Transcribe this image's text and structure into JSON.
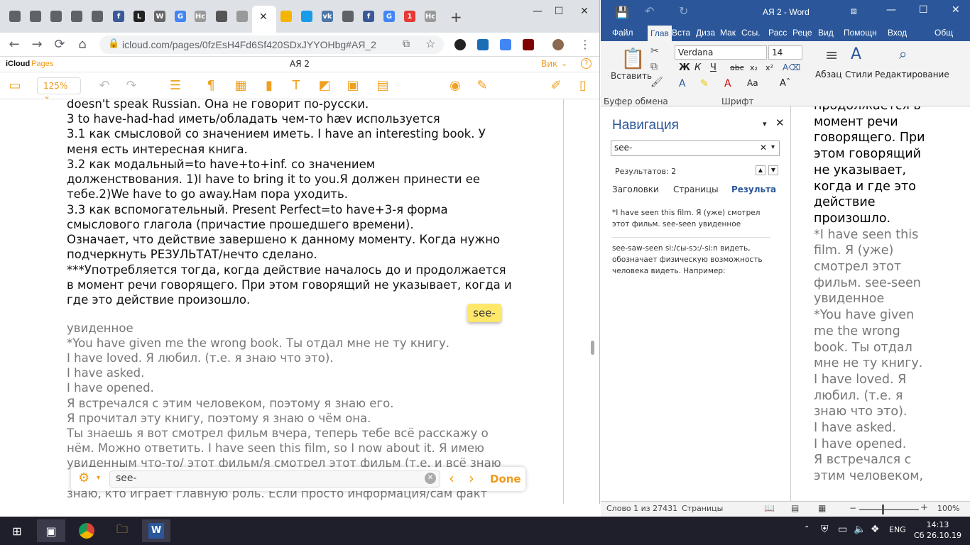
{
  "browser": {
    "tabs": [
      {
        "icon": "generic-tab-icon",
        "color": "#5f6368"
      },
      {
        "icon": "generic-tab-icon",
        "color": "#5f6368"
      },
      {
        "icon": "generic-tab-icon",
        "color": "#5f6368"
      },
      {
        "icon": "generic-tab-icon",
        "color": "#5f6368"
      },
      {
        "icon": "generic-tab-icon",
        "color": "#5f6368"
      },
      {
        "icon": "facebook-icon",
        "label": "f",
        "color": "#3b5998"
      },
      {
        "icon": "letter-l-icon",
        "label": "L",
        "color": "#222222"
      },
      {
        "icon": "wikipedia-icon",
        "label": "W",
        "color": "#666666"
      },
      {
        "icon": "google-icon",
        "label": "G",
        "color": "#4285f4"
      },
      {
        "icon": "tab-text-icon",
        "label": "Нс",
        "color": "#999999"
      },
      {
        "icon": "gauge-icon",
        "color": "#555555"
      },
      {
        "icon": "apple-icon",
        "color": "#999999"
      }
    ],
    "tabs_right": [
      {
        "icon": "google-drive-icon",
        "color": "#f4b400"
      },
      {
        "icon": "circle-blue-icon",
        "color": "#1a9be8"
      },
      {
        "icon": "vk-icon",
        "label": "vk",
        "color": "#4a76a8"
      },
      {
        "icon": "generic-tab-icon",
        "color": "#5f6368"
      },
      {
        "icon": "facebook-icon",
        "label": "f",
        "color": "#3b5998"
      },
      {
        "icon": "google-icon",
        "label": "G",
        "color": "#4285f4"
      },
      {
        "icon": "notification-icon",
        "label": "1",
        "color": "#e53935"
      },
      {
        "icon": "tab-text-icon",
        "label": "Нс",
        "color": "#999999"
      }
    ],
    "url": "icloud.com/pages/0fzEsH4Fd6Sf420SDxJYYOHbg#АЯ_2"
  },
  "pages": {
    "brand": "iCloud",
    "app": "Pages",
    "doc_title": "АЯ 2",
    "user_label": "Вик",
    "zoom": "125%",
    "find_text": "see-",
    "find_done": "Done",
    "highlight_tag": "see-"
  },
  "doc_lines": [
    {
      "t": "doesn't speak Russian. Она не говорит по-русски.",
      "cls": ""
    },
    {
      "t": "3 to have-had-had иметь/обладать чем-то hæv используется",
      "cls": ""
    },
    {
      "t": "3.1 как смысловой со значением иметь. I have an interesting book. У",
      "cls": ""
    },
    {
      "t": "меня есть интересная книга.",
      "cls": ""
    },
    {
      "t": "3.2 как модальный=to have+to+inf. со значением",
      "cls": ""
    },
    {
      "t": "долженствования. 1)I have to bring it to you.Я должен принести ее",
      "cls": ""
    },
    {
      "t": "тебе.2)We have to go away.Нам пора уходить.",
      "cls": ""
    },
    {
      "t": "3.3 как вспомогательный. Present Perfect=to have+3-я форма",
      "cls": ""
    },
    {
      "t": "смыслового глагола (причастие прошедшего времени).",
      "cls": ""
    },
    {
      "t": "Означает, что действие завершено к данному моменту. Когда нужно",
      "cls": ""
    },
    {
      "t": "подчеркнуть РЕЗУЛЬТАТ/нечто сделано.",
      "cls": ""
    },
    {
      "t": "***Употребляется тогда, когда действие началось до и продолжается",
      "cls": ""
    },
    {
      "t": "в момент речи говорящего. При этом говорящий не указывает, когда и",
      "cls": ""
    },
    {
      "t": "где это действие произошло.",
      "cls": ""
    },
    {
      "t": "увиденное",
      "cls": "gray"
    },
    {
      "t": "*You have given me the wrong book. Ты отдал мне не ту книгу.",
      "cls": "gray"
    },
    {
      "t": "I have loved. Я любил. (т.е. я знаю что это).",
      "cls": "gray"
    },
    {
      "t": "I have asked.",
      "cls": "gray"
    },
    {
      "t": "I have opened.",
      "cls": "gray"
    },
    {
      "t": "Я встречался с этим человеком, поэтому я знаю его.",
      "cls": "gray"
    },
    {
      "t": "Я прочитал эту книгу, поэтому я знаю о чём она.",
      "cls": "gray"
    },
    {
      "t": "Ты знаешь я вот смотрел фильм вчера, теперь тебе всё расскажу о",
      "cls": "gray"
    },
    {
      "t": "нём. Можно ответить. I have seen this film, so I now about it. Я имею",
      "cls": "gray"
    },
    {
      "t": "увиденным что-то/ этот фильм/я смотрел этот фильм (т.е. и всё знаю",
      "cls": "gray"
    },
    {
      "t": "знаю, кто играет главную роль. Если просто информация/сам факт",
      "cls": "gray"
    }
  ],
  "word": {
    "title": "АЯ 2 - Word",
    "tabs": [
      "Файл",
      "Глав",
      "Вста",
      "Диза",
      "Мак",
      "Ссы.",
      "Расс",
      "Реце",
      "Вид",
      "Помощн",
      "Вход",
      "Общ"
    ],
    "font_name": "Verdana",
    "font_size": "14",
    "paste_label": "Вставить",
    "clipboard_label": "Буфер обмена",
    "font_group": "Шрифт",
    "paragraph_label": "Абзац",
    "styles_label": "Стили",
    "editing_label": "Редактирование",
    "nav_title": "Навигация",
    "nav_search": "see-",
    "results_count": "Результатов: 2",
    "nav_tabs": [
      "Заголовки",
      "Страницы",
      "Результа"
    ],
    "result1": "*I have seen this film. Я (уже) смотрел этот фильм. see-seen увиденное",
    "result2": "see-saw-seen si:/сы-sɔ:/-si:n видеть, обозначает физическую возможность человека видеть. Например:",
    "status_words": "Слово 1 из 27431",
    "status_pages": "Страницы",
    "zoom": "100%"
  },
  "word_lines": [
    {
      "t": "продолжается в",
      "cls": ""
    },
    {
      "t": "момент речи",
      "cls": ""
    },
    {
      "t": "говорящего. При",
      "cls": ""
    },
    {
      "t": "этом говорящий",
      "cls": ""
    },
    {
      "t": "не указывает,",
      "cls": ""
    },
    {
      "t": "когда и где это",
      "cls": ""
    },
    {
      "t": "действие",
      "cls": ""
    },
    {
      "t": "произошло.",
      "cls": ""
    },
    {
      "t": "*I have seen this",
      "cls": "gray"
    },
    {
      "t": "film. Я (уже)",
      "cls": "gray"
    },
    {
      "t": "смотрел этот",
      "cls": "gray"
    },
    {
      "t": "фильм. see-seen",
      "cls": "gray"
    },
    {
      "t": "увиденное",
      "cls": "gray"
    },
    {
      "t": "*You have given",
      "cls": "gray"
    },
    {
      "t": "me the wrong",
      "cls": "gray"
    },
    {
      "t": "book. Ты отдал",
      "cls": "gray"
    },
    {
      "t": "мне не ту книгу.",
      "cls": "gray"
    },
    {
      "t": "I have loved. Я",
      "cls": "gray"
    },
    {
      "t": "любил. (т.е. я",
      "cls": "gray"
    },
    {
      "t": "знаю что это).",
      "cls": "gray"
    },
    {
      "t": "I have asked.",
      "cls": "gray"
    },
    {
      "t": "I have opened.",
      "cls": "gray"
    },
    {
      "t": "Я встречался с",
      "cls": "gray"
    },
    {
      "t": "этим человеком,",
      "cls": "gray"
    }
  ],
  "taskbar": {
    "lang": "ENG",
    "time": "14:13",
    "date": "Сб 26.10.19"
  }
}
